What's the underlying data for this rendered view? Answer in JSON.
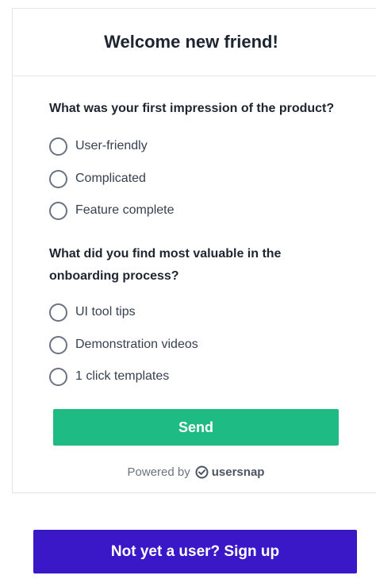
{
  "survey": {
    "title": "Welcome new friend!",
    "questions": [
      {
        "text": "What was your first impression of the product?",
        "options": [
          "User-friendly",
          "Complicated",
          "Feature complete"
        ]
      },
      {
        "text": "What did you find most valuable in the onboarding process?",
        "options": [
          "UI tool tips",
          "Demonstration videos",
          "1 click templates"
        ]
      }
    ],
    "send_label": "Send",
    "powered_by": "Powered by",
    "brand_name": "usersnap"
  },
  "signup": {
    "label": "Not yet a user? Sign up"
  },
  "colors": {
    "send_button": "#1ebc84",
    "signup_button": "#3a18c8",
    "border": "#e3e5e8",
    "radio_border": "#6b7280"
  },
  "icons": {
    "radio": "radio-unchecked-icon",
    "brand": "usersnap-logo-icon"
  }
}
